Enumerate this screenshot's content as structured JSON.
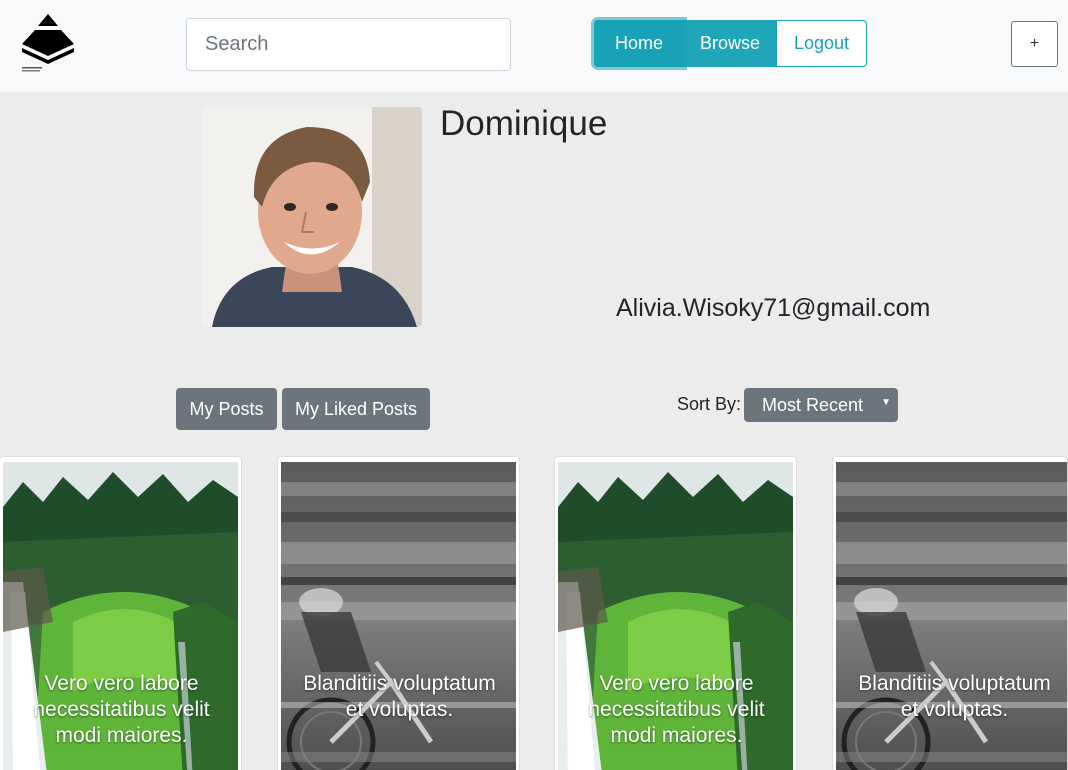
{
  "navbar": {
    "logo_icon": "pyramid-logo-icon",
    "search_placeholder": "Search",
    "home_label": "Home",
    "browse_label": "Browse",
    "logout_label": "Logout",
    "add_label": "+",
    "accent_color": "#17a2b8"
  },
  "profile": {
    "name": "Dominique",
    "email": "Alivia.Wisoky71@gmail.com"
  },
  "tabs": {
    "my_posts": "My Posts",
    "my_liked_posts": "My Liked Posts"
  },
  "sort": {
    "label": "Sort By:",
    "selected": "Most Recent"
  },
  "posts": [
    {
      "caption": "Vero vero labore necessitatibus velit modi maiores.",
      "image": "waterfall-forest-image"
    },
    {
      "caption": "Blanditiis voluptatum et voluptas.",
      "image": "cyclist-motion-blur-image"
    },
    {
      "caption": "Vero vero labore necessitatibus velit modi maiores.",
      "image": "waterfall-forest-image"
    },
    {
      "caption": "Blanditiis voluptatum et voluptas.",
      "image": "cyclist-motion-blur-image"
    }
  ]
}
